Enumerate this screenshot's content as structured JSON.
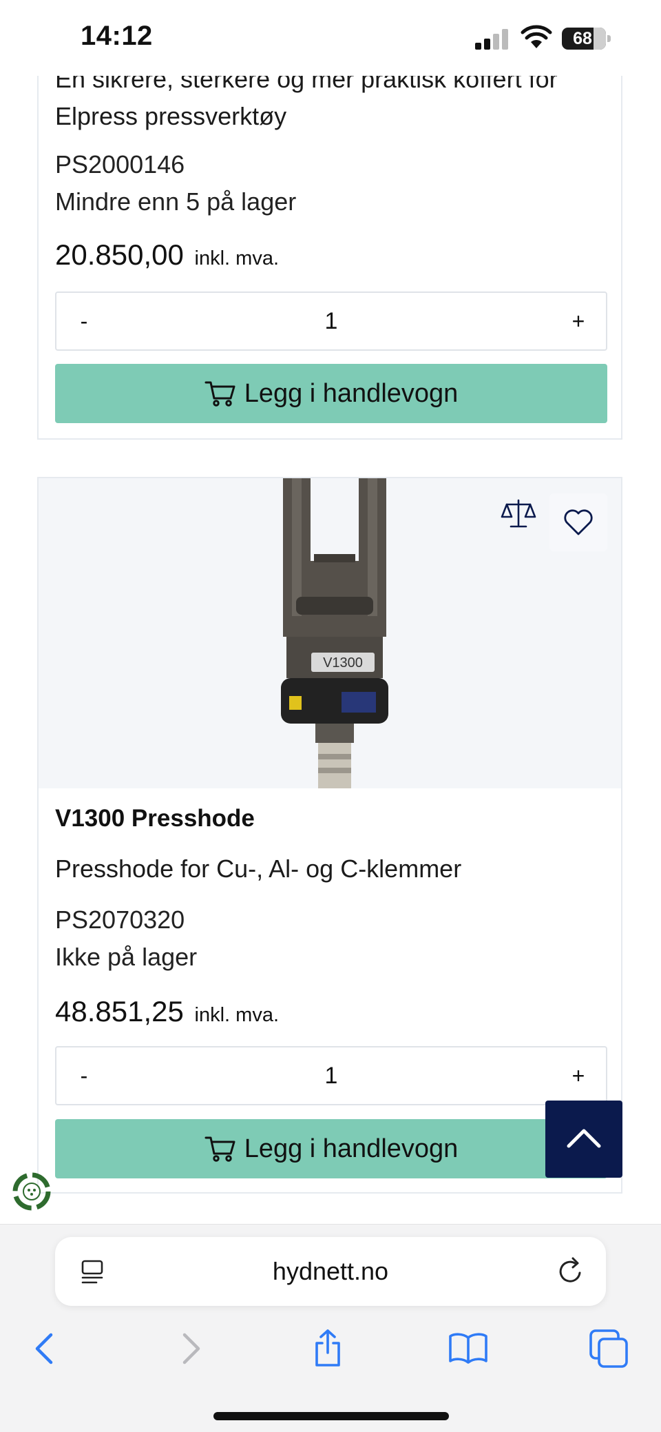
{
  "status_bar": {
    "time": "14:12",
    "battery": "68"
  },
  "products": [
    {
      "description_line1": "En sikrere, sterkere og mer praktisk koffert for",
      "description_line2": "Elpress pressverktøy",
      "sku": "PS2000146",
      "stock": "Mindre enn 5 på lager",
      "price": "20.850,00",
      "price_suffix": "inkl. mva.",
      "qty_minus": "-",
      "quantity": "1",
      "qty_plus": "+",
      "add_to_cart": "Legg i handlevogn"
    },
    {
      "image_label": "V1300",
      "title": "V1300 Presshode",
      "description": "Presshode for Cu-, Al- og C-klemmer",
      "sku": "PS2070320",
      "stock": "Ikke på lager",
      "price": "48.851,25",
      "price_suffix": "inkl. mva.",
      "qty_minus": "-",
      "quantity": "1",
      "qty_plus": "+",
      "add_to_cart": "Legg i handlevogn"
    }
  ],
  "browser": {
    "url": "hydnett.no"
  },
  "colors": {
    "add_button": "#7ecbb5",
    "scroll_top": "#0b1a4d",
    "browser_blue": "#2f7bf6"
  },
  "icons": [
    "cart-icon",
    "compare-scale-icon",
    "heart-icon",
    "chevron-up-icon",
    "recycle-badge-icon",
    "reader-icon",
    "reload-icon",
    "back-icon",
    "forward-icon",
    "share-icon",
    "bookmarks-icon",
    "tabs-icon"
  ]
}
